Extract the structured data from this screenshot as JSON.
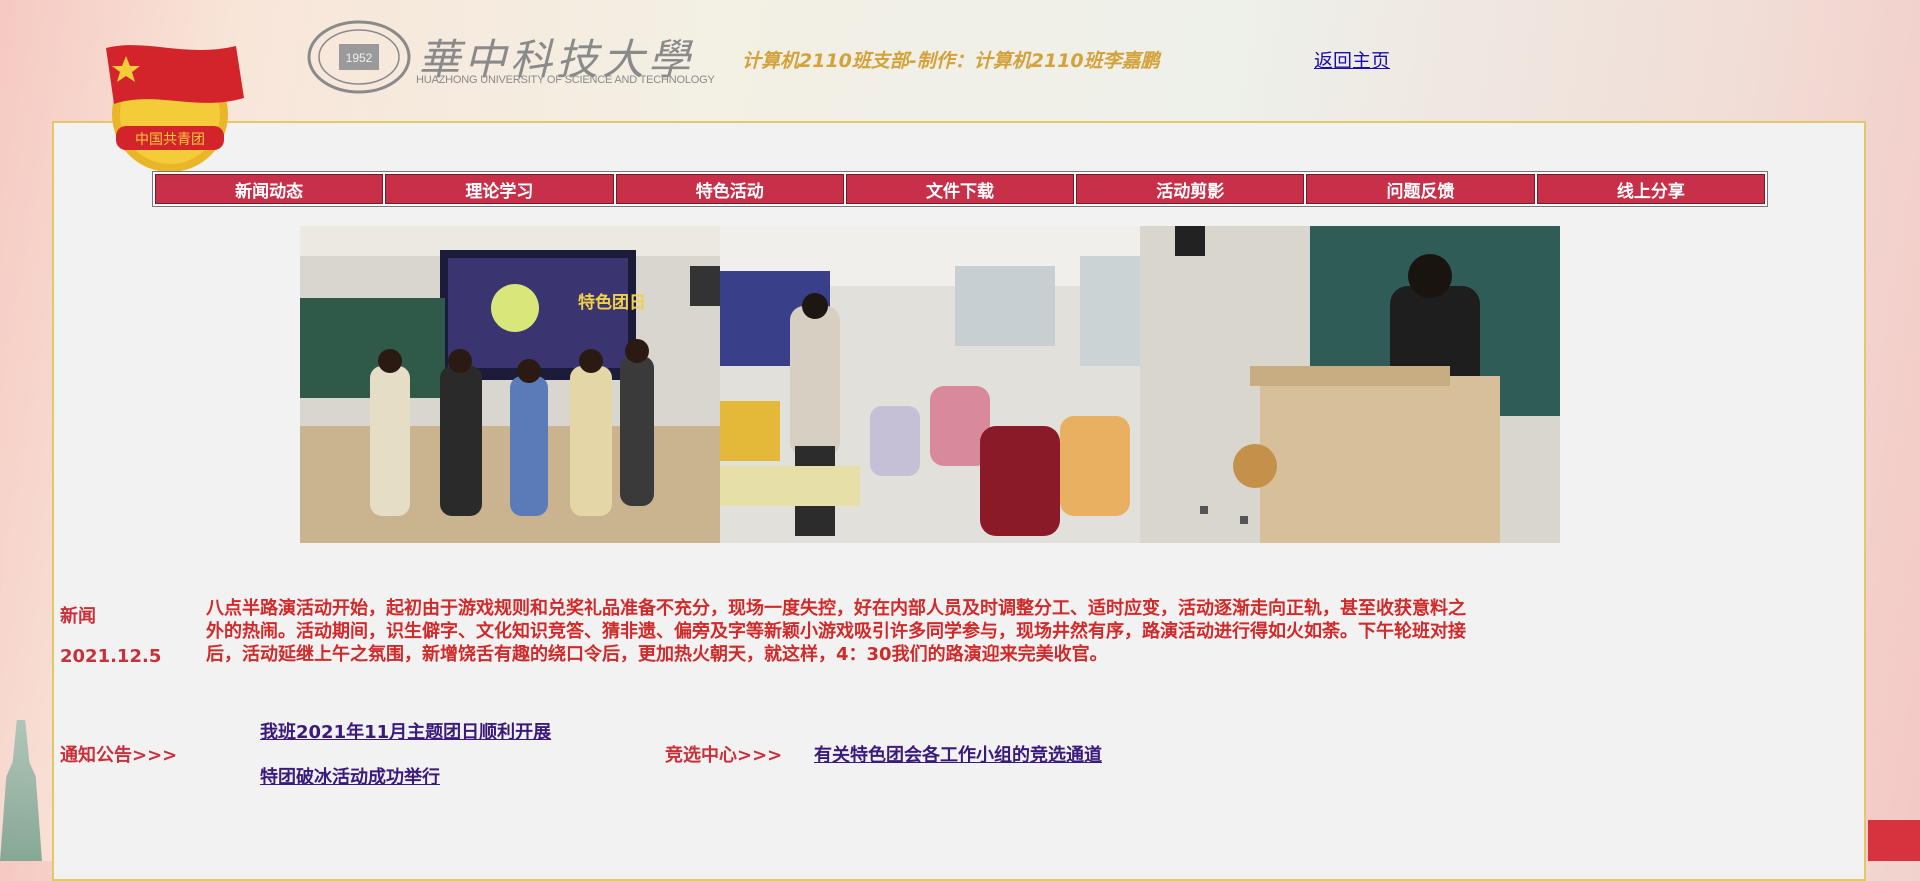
{
  "header": {
    "university_name_cn": "華中科技大學",
    "university_name_en": "HUAZHONG UNIVERSITY OF SCIENCE AND TECHNOLOGY",
    "credit": "计算机2110班支部-制作：计算机2110班李嘉鹏",
    "home_link": "返回主页"
  },
  "emblem": {
    "text": "中国共青团"
  },
  "nav": {
    "items": [
      {
        "label": "新闻动态"
      },
      {
        "label": "理论学习"
      },
      {
        "label": "特色活动"
      },
      {
        "label": "文件下载"
      },
      {
        "label": "活动剪影"
      },
      {
        "label": "问题反馈"
      },
      {
        "label": "线上分享"
      }
    ]
  },
  "photos": {
    "slide_title": "特色团日"
  },
  "news": {
    "label": "新闻",
    "date": "2021.12.5",
    "text": "八点半路演活动开始，起初由于游戏规则和兑奖礼品准备不充分，现场一度失控，好在内部人员及时调整分工、适时应变，活动逐渐走向正轨，甚至收获意料之外的热闹。活动期间，识生僻字、文化知识竞答、猜非遗、偏旁及字等新颖小游戏吸引许多同学参与，现场井然有序，路演活动进行得如火如荼。下午轮班对接后，活动延继上午之氛围，新增饶舌有趣的绕口令后，更加热火朝天，就这样，4：30我们的路演迎来完美收官。"
  },
  "notices": {
    "label": "通知公告>>>",
    "links": [
      {
        "text": "我班2021年11月主题团日顺利开展"
      },
      {
        "text": "特团破冰活动成功举行"
      }
    ]
  },
  "election": {
    "label": "竞选中心>>>",
    "link": "有关特色团会各工作小组的竞选通道"
  },
  "colors": {
    "nav_bg": "#c8304a",
    "accent_red": "#c8303a",
    "credit_gold": "#d3a23a",
    "link_purple": "#3a1a7a"
  }
}
